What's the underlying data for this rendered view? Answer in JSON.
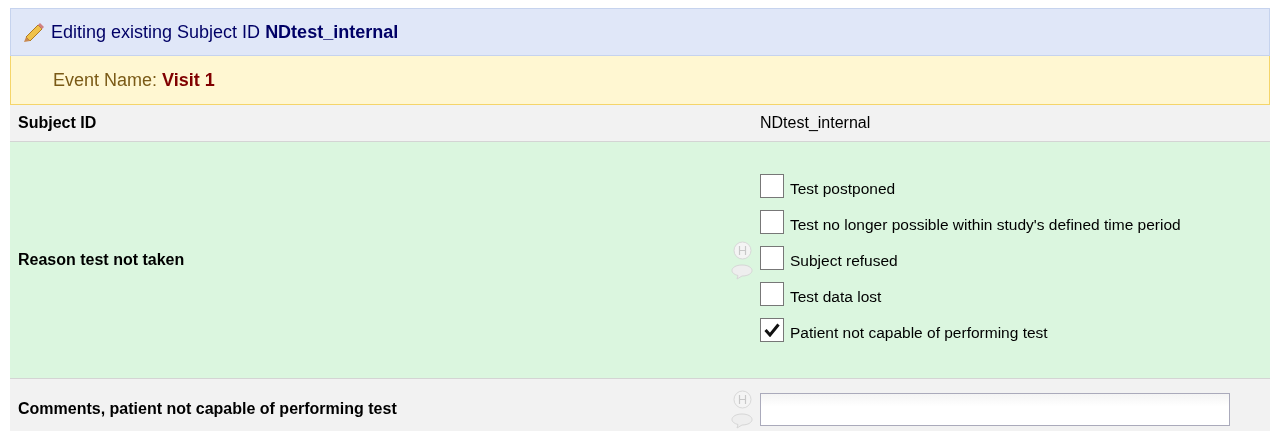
{
  "header": {
    "title": "Editing existing Subject ID **NDtest_internal**"
  },
  "event": {
    "label": "Event Name:",
    "value": "Visit 1"
  },
  "fields": [
    {
      "kind": "text",
      "label": "Subject ID",
      "value": "NDtest_internal"
    },
    {
      "kind": "checkboxes",
      "label": "Reason test not taken",
      "options": [
        {
          "label": "Test postponed",
          "checked": false
        },
        {
          "label": "Test no longer possible within study's defined time period",
          "checked": false
        },
        {
          "label": "Subject refused",
          "checked": false
        },
        {
          "label": "Test data lost",
          "checked": false
        },
        {
          "label": "Patient not capable of performing test",
          "checked": true
        }
      ]
    },
    {
      "kind": "input",
      "label": "Comments, patient not capable of performing test"
    }
  ]
}
